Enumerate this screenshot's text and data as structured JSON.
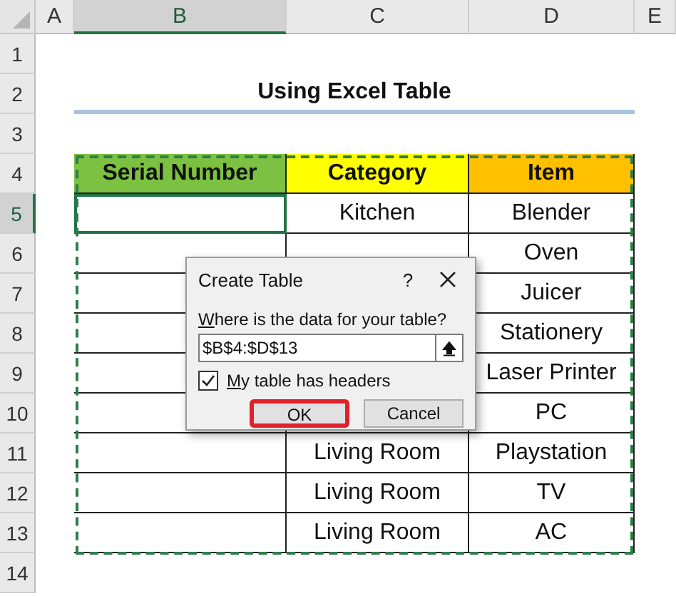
{
  "column_headers": [
    {
      "label": "A",
      "selected": false
    },
    {
      "label": "B",
      "selected": true
    },
    {
      "label": "C",
      "selected": false
    },
    {
      "label": "D",
      "selected": false
    },
    {
      "label": "E",
      "selected": false
    }
  ],
  "row_headers": [
    {
      "label": "1",
      "selected": false
    },
    {
      "label": "2",
      "selected": false
    },
    {
      "label": "3",
      "selected": false
    },
    {
      "label": "4",
      "selected": false
    },
    {
      "label": "5",
      "selected": true
    },
    {
      "label": "6",
      "selected": false
    },
    {
      "label": "7",
      "selected": false
    },
    {
      "label": "8",
      "selected": false
    },
    {
      "label": "9",
      "selected": false
    },
    {
      "label": "10",
      "selected": false
    },
    {
      "label": "11",
      "selected": false
    },
    {
      "label": "12",
      "selected": false
    },
    {
      "label": "13",
      "selected": false
    },
    {
      "label": "14",
      "selected": false
    }
  ],
  "sheet_title": "Using Excel Table",
  "table": {
    "columns": [
      {
        "label": "Serial Number",
        "color": "#7cc142"
      },
      {
        "label": "Category",
        "color": "#ffff00"
      },
      {
        "label": "Item",
        "color": "#ffc000"
      }
    ],
    "rows": [
      {
        "selected": true,
        "category": "Kitchen",
        "item": "Blender"
      },
      {
        "selected": false,
        "item": "Oven"
      },
      {
        "selected": false,
        "item": "Juicer"
      },
      {
        "selected": false,
        "item": "Stationery"
      },
      {
        "selected": false,
        "item": "Laser Printer"
      },
      {
        "selected": false,
        "item": "PC"
      },
      {
        "selected": false,
        "category": "Living Room",
        "item": "Playstation"
      },
      {
        "selected": false,
        "category": "Living Room",
        "item": "TV"
      },
      {
        "selected": false,
        "category": "Living Room",
        "item": "AC"
      }
    ]
  },
  "dialog": {
    "title": "Create Table",
    "help": "?",
    "prompt": "Where is the data for your table?",
    "range": "$B$4:$D$13",
    "headers_checkbox": {
      "label": "My table has headers",
      "checked": true
    },
    "buttons": [
      {
        "label": "OK",
        "highlighted": true
      },
      {
        "label": "Cancel",
        "highlighted": false
      }
    ]
  }
}
